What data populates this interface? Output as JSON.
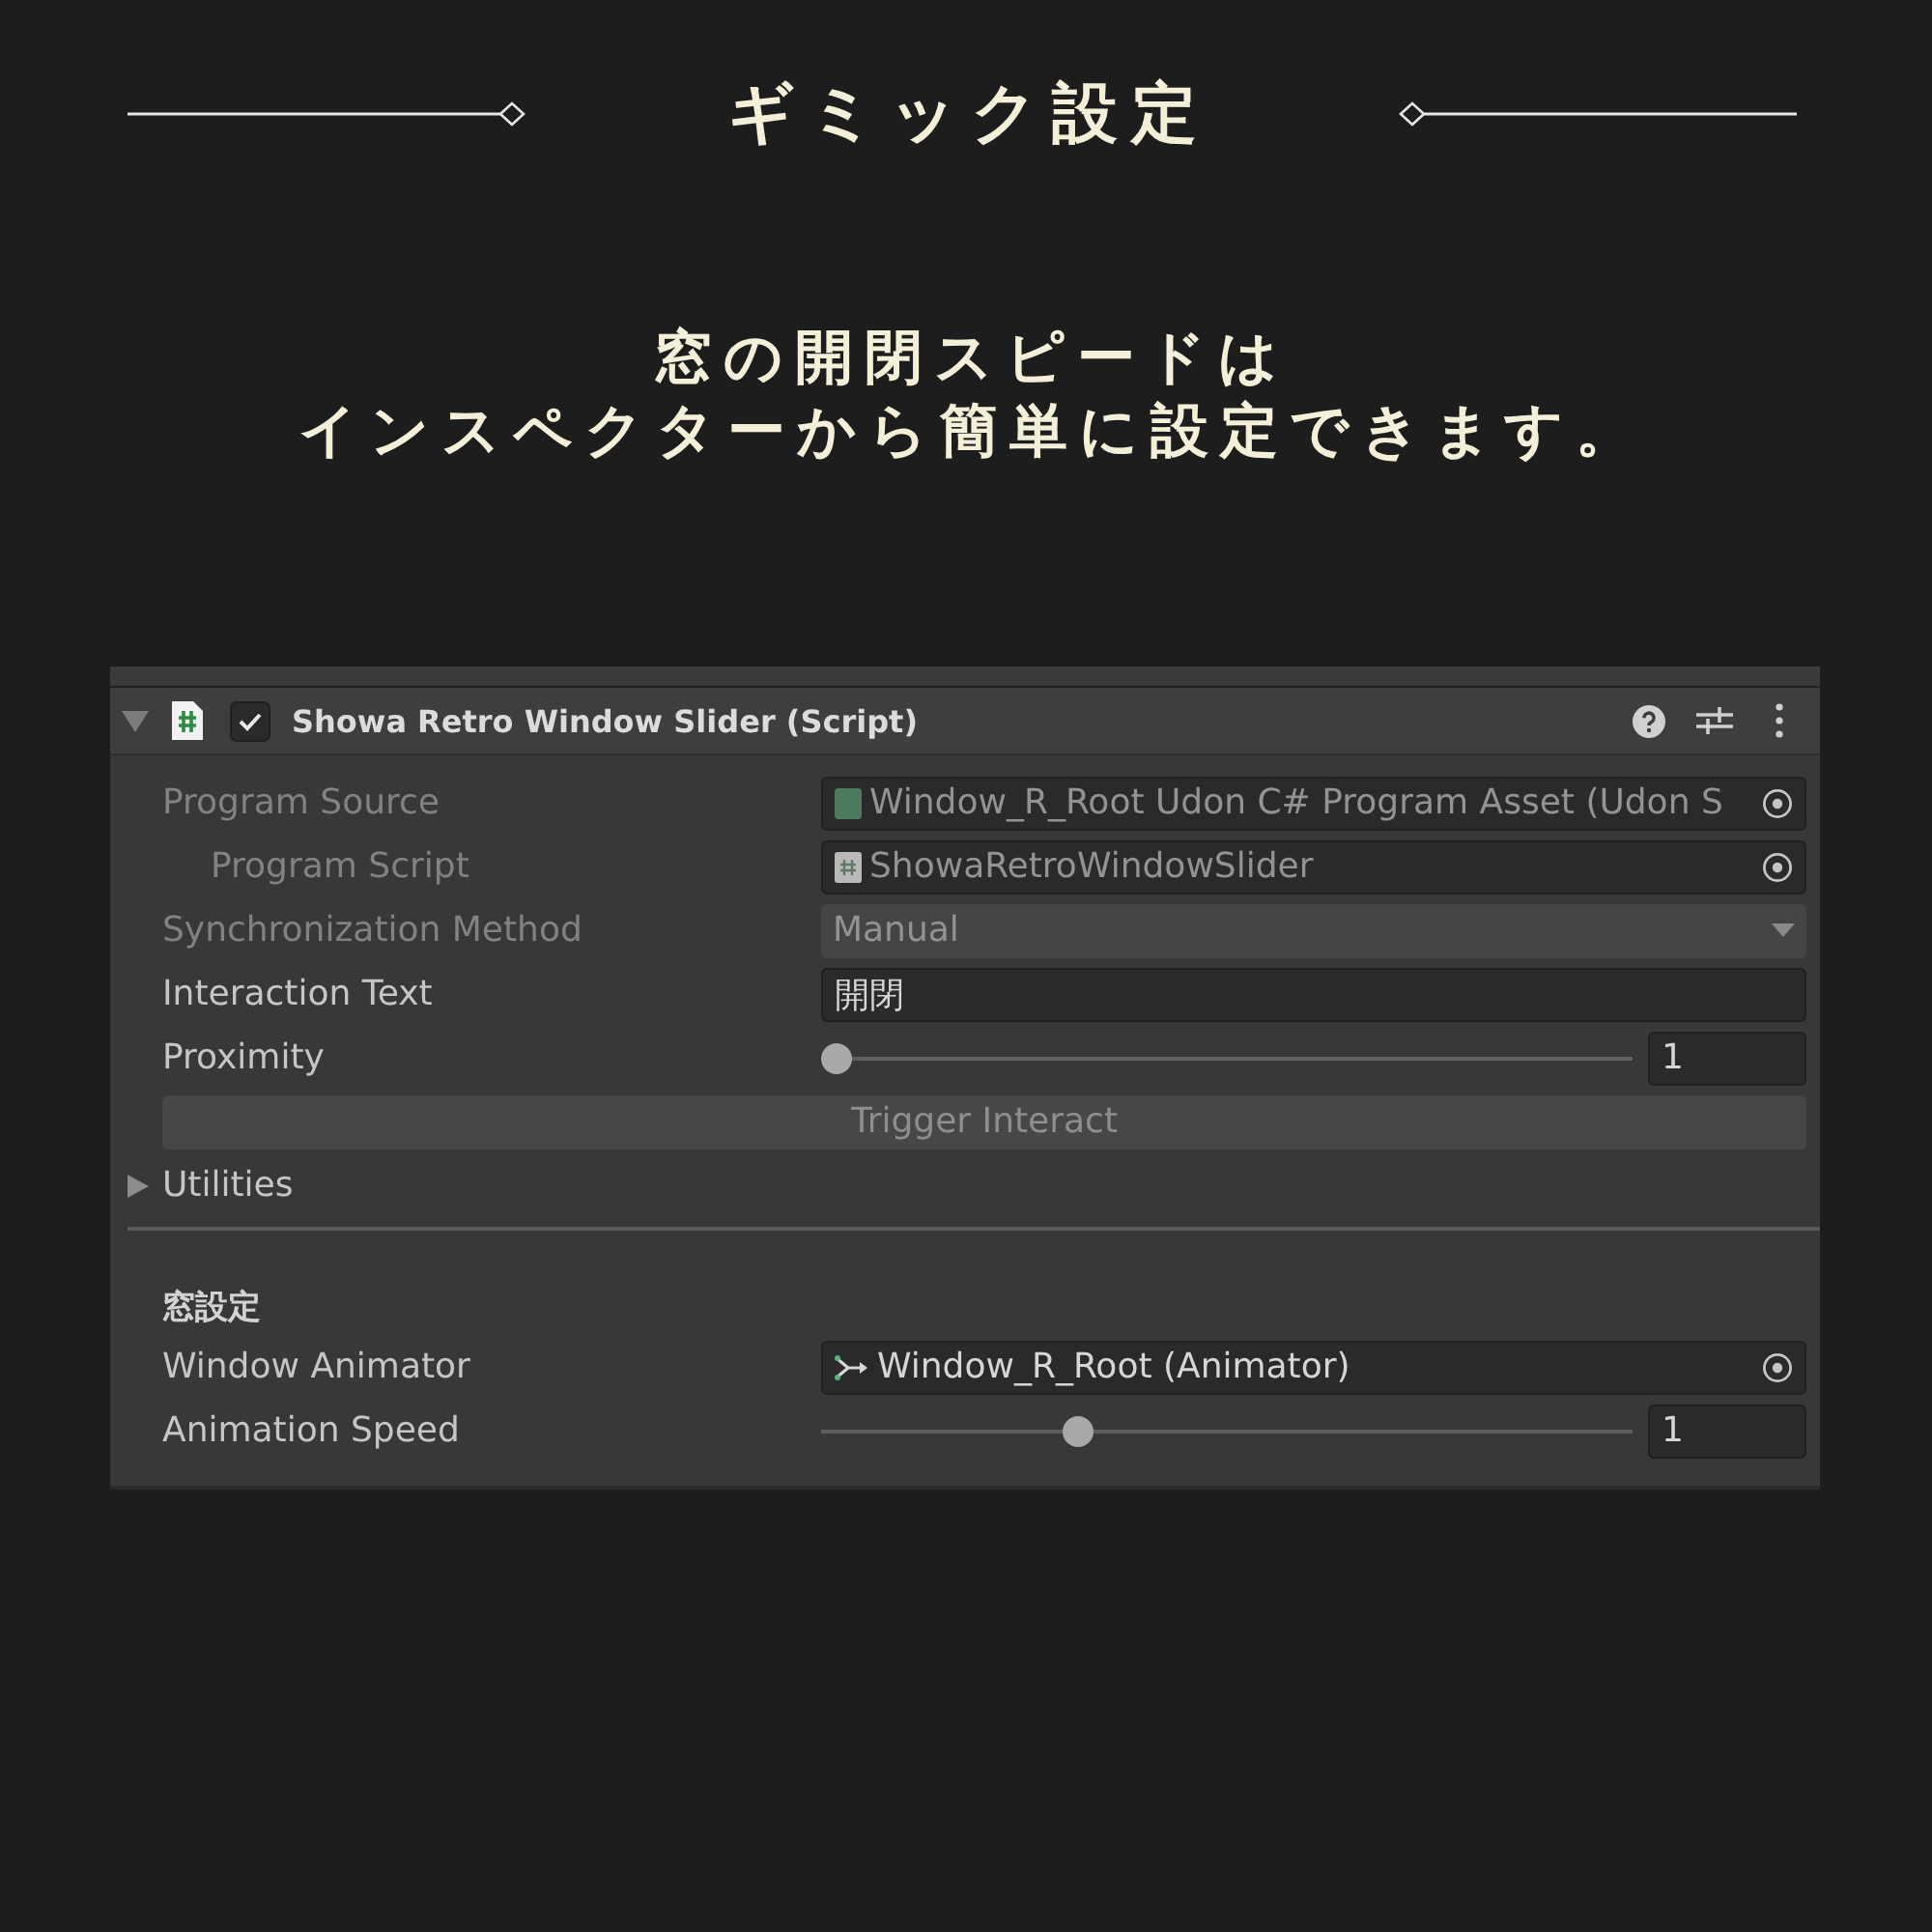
{
  "title": "ギミック設定",
  "subtitle": [
    "窓の開閉スピードは",
    "インスペクターから簡単に設定できます。"
  ],
  "inspector": {
    "component": {
      "title": "Showa Retro Window Slider (Script)",
      "expanded": true,
      "enabled": true
    },
    "rows": [
      {
        "kind": "asset",
        "label": "Program Source",
        "value": "Window_R_Root Udon C# Program Asset (Udon S",
        "disabled": true,
        "children": [
          {
            "kind": "script",
            "label": "Program Script",
            "value": "ShowaRetroWindowSlider",
            "disabled": true
          }
        ]
      },
      {
        "kind": "dropdown",
        "label": "Synchronization Method",
        "value": "Manual",
        "disabled": true
      },
      {
        "kind": "text",
        "label": "Interaction Text",
        "value": "開閉",
        "disabled": false
      },
      {
        "kind": "slider",
        "label": "Proximity",
        "level": 0,
        "value": "1",
        "disabled": false
      },
      {
        "kind": "button",
        "label": "Trigger Interact",
        "disabled": true
      },
      {
        "kind": "foldout",
        "label": "Utilities",
        "expanded": false,
        "disabled": false
      }
    ],
    "section": {
      "heading": "窓設定",
      "rows": [
        {
          "kind": "animator",
          "label": "Window Animator",
          "value": "Window_R_Root (Animator)",
          "disabled": false
        },
        {
          "kind": "slider",
          "label": "Animation Speed",
          "level": 0.31,
          "value": "1",
          "disabled": false
        }
      ]
    }
  }
}
